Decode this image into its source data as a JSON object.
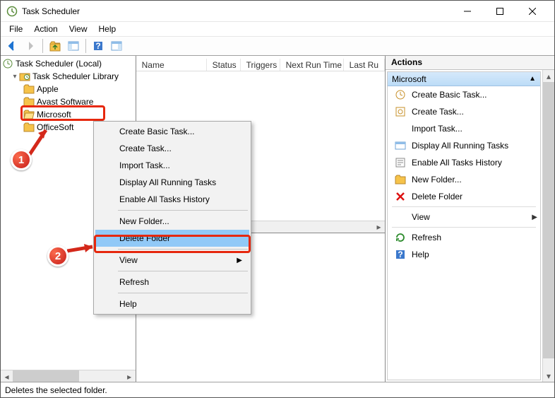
{
  "title": "Task Scheduler",
  "menubar": [
    "File",
    "Action",
    "View",
    "Help"
  ],
  "tree": {
    "root": "Task Scheduler (Local)",
    "library": "Task Scheduler Library",
    "children": [
      "Apple",
      "Avast Software",
      "Microsoft",
      "OfficeSoft"
    ],
    "selected": "Microsoft"
  },
  "list": {
    "columns": [
      "Name",
      "Status",
      "Triggers",
      "Next Run Time",
      "Last Ru"
    ]
  },
  "context_menu": {
    "items": [
      "Create Basic Task...",
      "Create Task...",
      "Import Task...",
      "Display All Running Tasks",
      "Enable All Tasks History",
      "-",
      "New Folder...",
      "Delete Folder",
      "-",
      "View",
      "-",
      "Refresh",
      "-",
      "Help"
    ],
    "selected": "Delete Folder",
    "submenu_item": "View"
  },
  "actions": {
    "title": "Actions",
    "section": "Microsoft",
    "rows": [
      {
        "icon": "basic-task",
        "label": "Create Basic Task..."
      },
      {
        "icon": "task",
        "label": "Create Task..."
      },
      {
        "icon": "none",
        "label": "Import Task..."
      },
      {
        "icon": "running",
        "label": "Display All Running Tasks"
      },
      {
        "icon": "history",
        "label": "Enable All Tasks History"
      },
      {
        "icon": "folder",
        "label": "New Folder..."
      },
      {
        "icon": "delete",
        "label": "Delete Folder"
      },
      {
        "sep": true
      },
      {
        "icon": "none",
        "label": "View",
        "submenu": true
      },
      {
        "sep": true
      },
      {
        "icon": "refresh",
        "label": "Refresh"
      },
      {
        "icon": "help",
        "label": "Help"
      }
    ]
  },
  "status": "Deletes the selected folder.",
  "callouts": {
    "c1": "1",
    "c2": "2"
  }
}
